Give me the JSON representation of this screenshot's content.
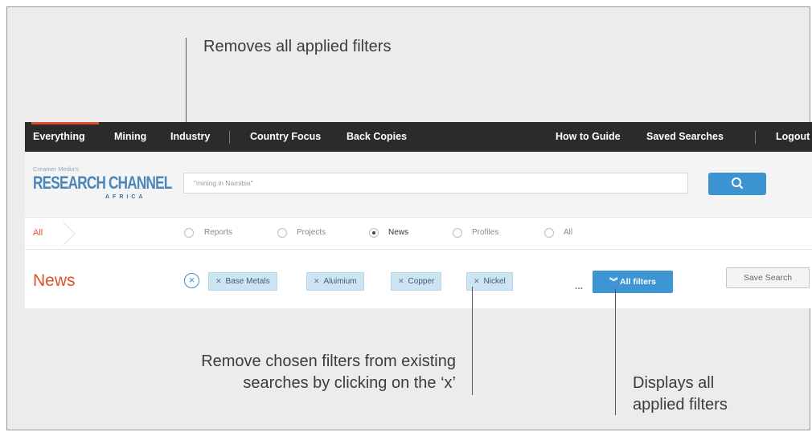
{
  "annotations": {
    "clear_all": "Removes all applied filters",
    "remove_chip_line1": "Remove chosen filters from existing",
    "remove_chip_line2": "searches by clicking on the ‘x’",
    "all_filters_line1": "Displays all",
    "all_filters_line2": "applied filters"
  },
  "topnav": {
    "left": [
      "Everything",
      "Mining",
      "Industry",
      "Country Focus",
      "Back Copies"
    ],
    "right": [
      "How to Guide",
      "Saved Searches",
      "Logout"
    ],
    "accent_color": "#e0512a"
  },
  "logo": {
    "small": "Creamer Media's",
    "main": "RESEARCH CHANNEL",
    "sub": "AFRICA"
  },
  "search": {
    "value": "\"mining in Namibia\"",
    "button_icon": "search-icon"
  },
  "breadcrumb": {
    "label": "All"
  },
  "content_types": {
    "options": [
      "Reports",
      "Projects",
      "News",
      "Profiles",
      "All"
    ],
    "selected": "News"
  },
  "results": {
    "title": "News",
    "clear_icon": "clear-circle-x-icon",
    "filters": [
      "Base Metals",
      "Aluimium",
      "Copper",
      "Nickel"
    ],
    "more": "...",
    "all_filters_label": "All filters",
    "save_search_label": "Save Search"
  }
}
